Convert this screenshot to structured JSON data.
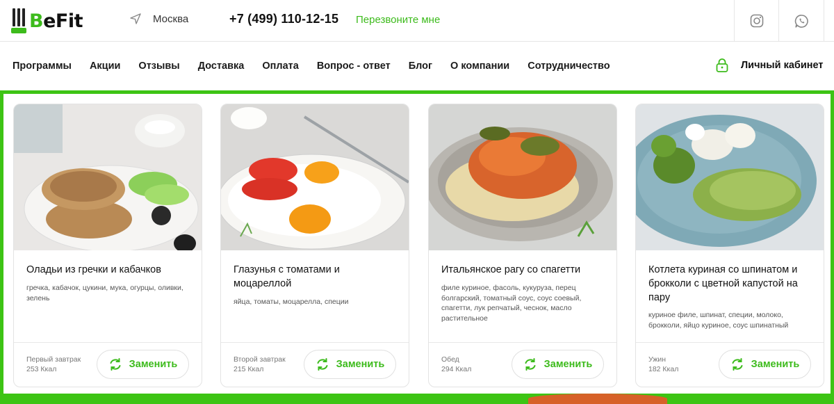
{
  "header": {
    "logo": {
      "b": "B",
      "rest": "eFit"
    },
    "city": "Москва",
    "phone": "+7 (499) 110-12-15",
    "callback": "Перезвоните мне",
    "social": [
      "instagram-icon",
      "whatsapp-icon"
    ]
  },
  "nav": {
    "items": [
      "Программы",
      "Акции",
      "Отзывы",
      "Доставка",
      "Оплата",
      "Вопрос - ответ",
      "Блог",
      "О компании",
      "Сотрудничество"
    ],
    "cabinet": "Личный кабинет"
  },
  "colors": {
    "accent": "#3dbb1c",
    "frame": "#3dc414"
  },
  "cards": [
    {
      "title": "Оладьи из гречки и кабачков",
      "ingredients": "гречка, кабачок, цукини, мука, огурцы, оливки, зелень",
      "meal": "Первый завтрак",
      "kcal": "253 Ккал",
      "button": "Заменить"
    },
    {
      "title": "Глазунья с томатами и моцареллой",
      "ingredients": "яйца, томаты, моцарелла, специи",
      "meal": "Второй завтрак",
      "kcal": "215 Ккал",
      "button": "Заменить"
    },
    {
      "title": "Итальянское рагу со спагетти",
      "ingredients": "филе куриное, фасоль, кукуруза, перец болгарский, томатный соус, соус соевый, спагетти, лук репчатый, чеснок, масло растительное",
      "meal": "Обед",
      "kcal": "294 Ккал",
      "button": "Заменить"
    },
    {
      "title": "Котлета куриная со шпинатом и брокколи с цветной капустой на пару",
      "ingredients": "куриное филе, шпинат, специи, молоко, брокколи, яйцо куриное, соус шпинатный",
      "meal": "Ужин",
      "kcal": "182 Ккал",
      "button": "Заменить"
    }
  ]
}
